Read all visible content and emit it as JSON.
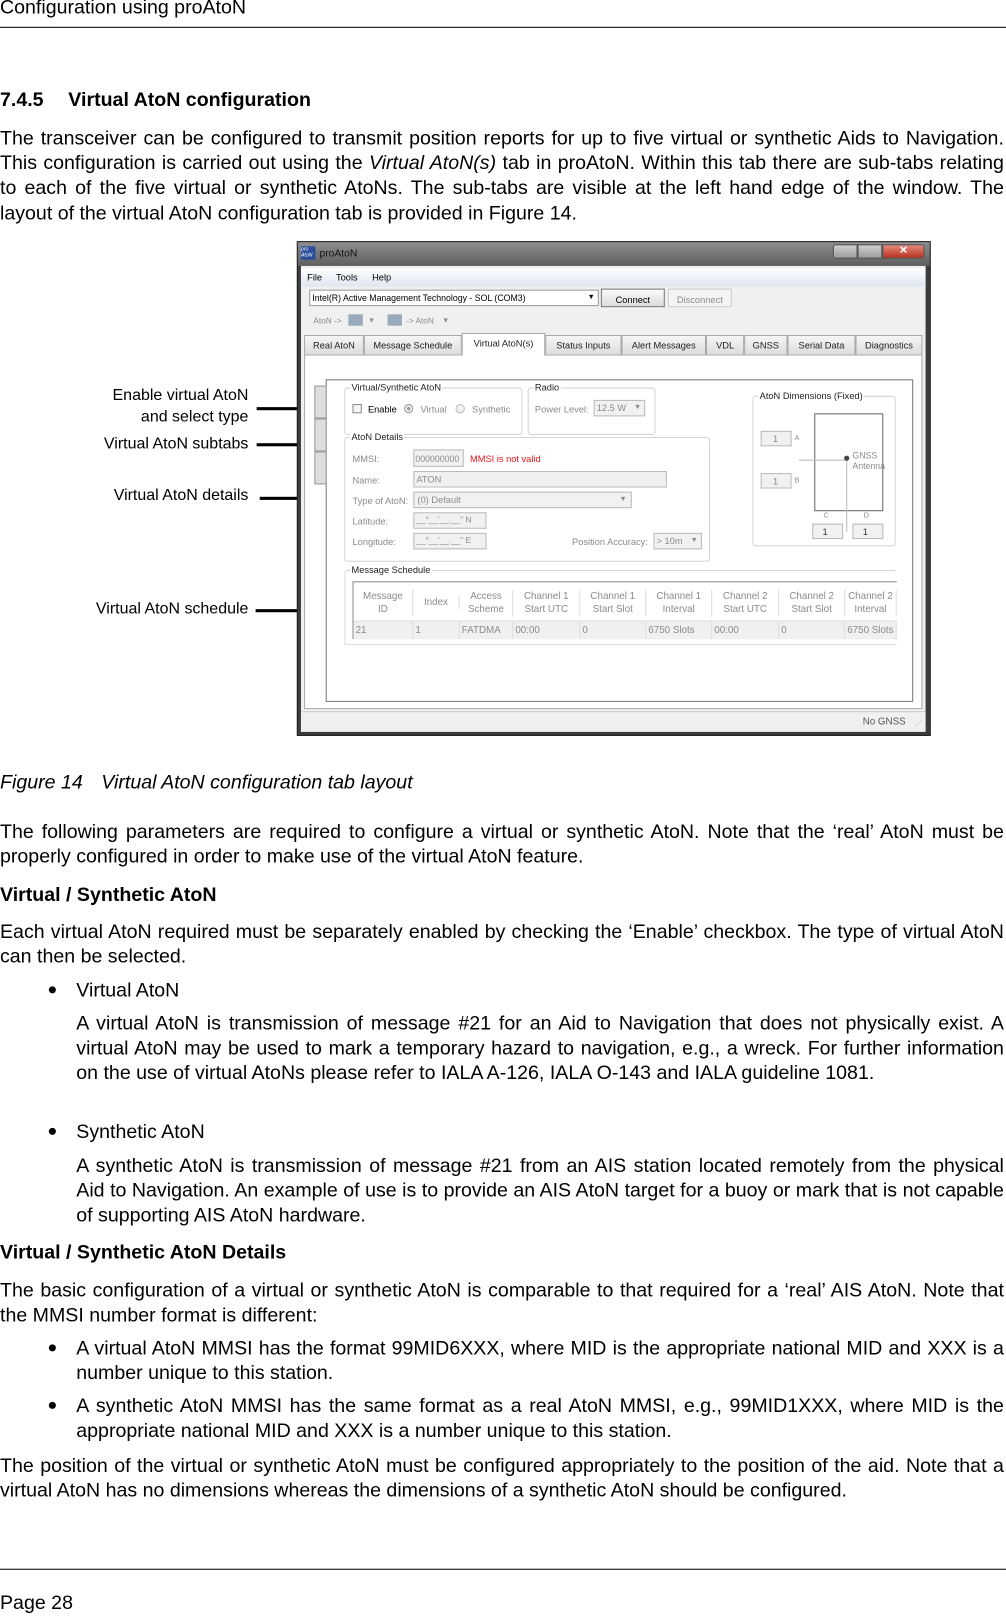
{
  "header": {
    "title": "Configuration using proAtoN"
  },
  "section": {
    "number": "7.4.5",
    "title": "Virtual AtoN configuration"
  },
  "intro": {
    "before": "The transceiver can be configured to transmit position reports for up to five virtual or synthetic Aids to Navigation. This configuration is carried out using the ",
    "italic": "Virtual AtoN(s)",
    "after": " tab in proAtoN. Within this tab there are sub-tabs relating to each of the five virtual or synthetic AtoNs. The sub-tabs are visible at the left hand edge of the window. The layout of the virtual AtoN configuration tab is provided in Figure 14."
  },
  "figure": {
    "callouts": [
      "Enable virtual AtoN",
      "and select type",
      "Virtual AtoN subtabs",
      "Virtual AtoN details",
      "Virtual AtoN schedule"
    ],
    "caption_number": "Figure 14",
    "caption_text": "Virtual AtoN configuration tab layout",
    "app": {
      "title": "proAtoN",
      "logo": "pro AtoN",
      "menu": [
        "File",
        "Tools",
        "Help"
      ],
      "port": "Intel(R) Active Management Technology - SOL (COM3)",
      "connect": "Connect",
      "disconnect": "Disconnect",
      "toolbar": [
        "AtoN ->",
        "-> AtoN"
      ],
      "tabs": [
        "Real AtoN",
        "Message Schedule",
        "Virtual AtoN(s)",
        "Status Inputs",
        "Alert Messages",
        "VDL",
        "GNSS",
        "Serial Data",
        "Diagnostics"
      ],
      "active_tab": "Virtual AtoN(s)",
      "vs_group": "Virtual/Synthetic AtoN",
      "enable": "Enable",
      "enable_checked": false,
      "virtual": "Virtual",
      "synthetic": "Synthetic",
      "selected_type": "Virtual",
      "radio_group": "Radio",
      "power_label": "Power Level:",
      "power_value": "12.5 W",
      "details_group": "AtoN Details",
      "mmsi_label": "MMSI:",
      "mmsi_value": "000000000",
      "mmsi_error": "MMSI is not valid",
      "error_color": "#e8141c",
      "name_label": "Name:",
      "name_value": "ATON",
      "type_label": "Type of AtoN:",
      "type_value": "(0) Default",
      "lat_label": "Latitude:",
      "lat_value": "__°__'__.__\" N",
      "lon_label": "Longitude:",
      "lon_value": "__°__'__.__\" E",
      "accuracy_label": "Position Accuracy:",
      "accuracy_value": "> 10m",
      "dims_group": "AtoN Dimensions (Fixed)",
      "dim_a": "1",
      "dim_b": "1",
      "dim_c": "1",
      "dim_d": "1",
      "labels": [
        "A",
        "B",
        "C",
        "D"
      ],
      "gnss": "GNSS",
      "antenna": "Antenna",
      "schedule_group": "Message Schedule",
      "columns": [
        [
          "Message",
          "ID"
        ],
        [
          "Index",
          ""
        ],
        [
          "Access",
          "Scheme"
        ],
        [
          "Channel 1",
          "Start UTC"
        ],
        [
          "Channel 1",
          "Start Slot"
        ],
        [
          "Channel 1",
          "Interval"
        ],
        [
          "Channel 2",
          "Start UTC"
        ],
        [
          "Channel 2",
          "Start Slot"
        ],
        [
          "Channel 2",
          "Interval"
        ]
      ],
      "row": [
        "21",
        "1",
        "FATDMA",
        "00:00",
        "0",
        "6750 Slots",
        "00:00",
        "0",
        "6750 Slots"
      ],
      "status": "No GNSS"
    }
  },
  "p2": "The following parameters are required to configure a virtual or synthetic AtoN. Note that the ‘real’ AtoN must be properly configured in order to make use of the virtual AtoN feature.",
  "h_vs": "Virtual / Synthetic AtoN",
  "p3": "Each virtual AtoN required must be separately enabled by checking the ‘Enable’ checkbox. The type of virtual AtoN can then be selected.",
  "b1_title": "Virtual AtoN",
  "b1_text": "A virtual AtoN is transmission of message #21 for an Aid to Navigation that does not physically exist. A virtual AtoN may be used to mark a temporary hazard to navigation, e.g., a wreck. For further information on the use of virtual AtoNs please refer to IALA A-126, IALA O-143 and IALA guideline 1081.",
  "b2_title": "Synthetic AtoN",
  "b2_text": "A synthetic AtoN is transmission of message #21 from an AIS station located remotely from the physical Aid to Navigation. An example of use is to provide an AIS AtoN target for a buoy or mark that is not capable of supporting AIS AtoN hardware.",
  "h_details": "Virtual / Synthetic AtoN Details",
  "p4": "The basic configuration of a virtual or synthetic AtoN is comparable to that required for a ‘real’ AIS AtoN. Note that the MMSI number format is different:",
  "b3": "A virtual AtoN MMSI has the format 99MID6XXX, where MID is the appropriate national MID and XXX is a number unique to this station.",
  "b4": "A synthetic AtoN MMSI has the same format as a real AtoN MMSI, e.g., 99MID1XXX, where MID is the appropriate national MID and XXX is a number unique to this station.",
  "p5": "The position of the virtual or synthetic AtoN must be configured appropriately to the position of the aid. Note that a virtual AtoN has no dimensions whereas the dimensions of a synthetic AtoN should be configured.",
  "footer": {
    "page": "Page 28"
  }
}
